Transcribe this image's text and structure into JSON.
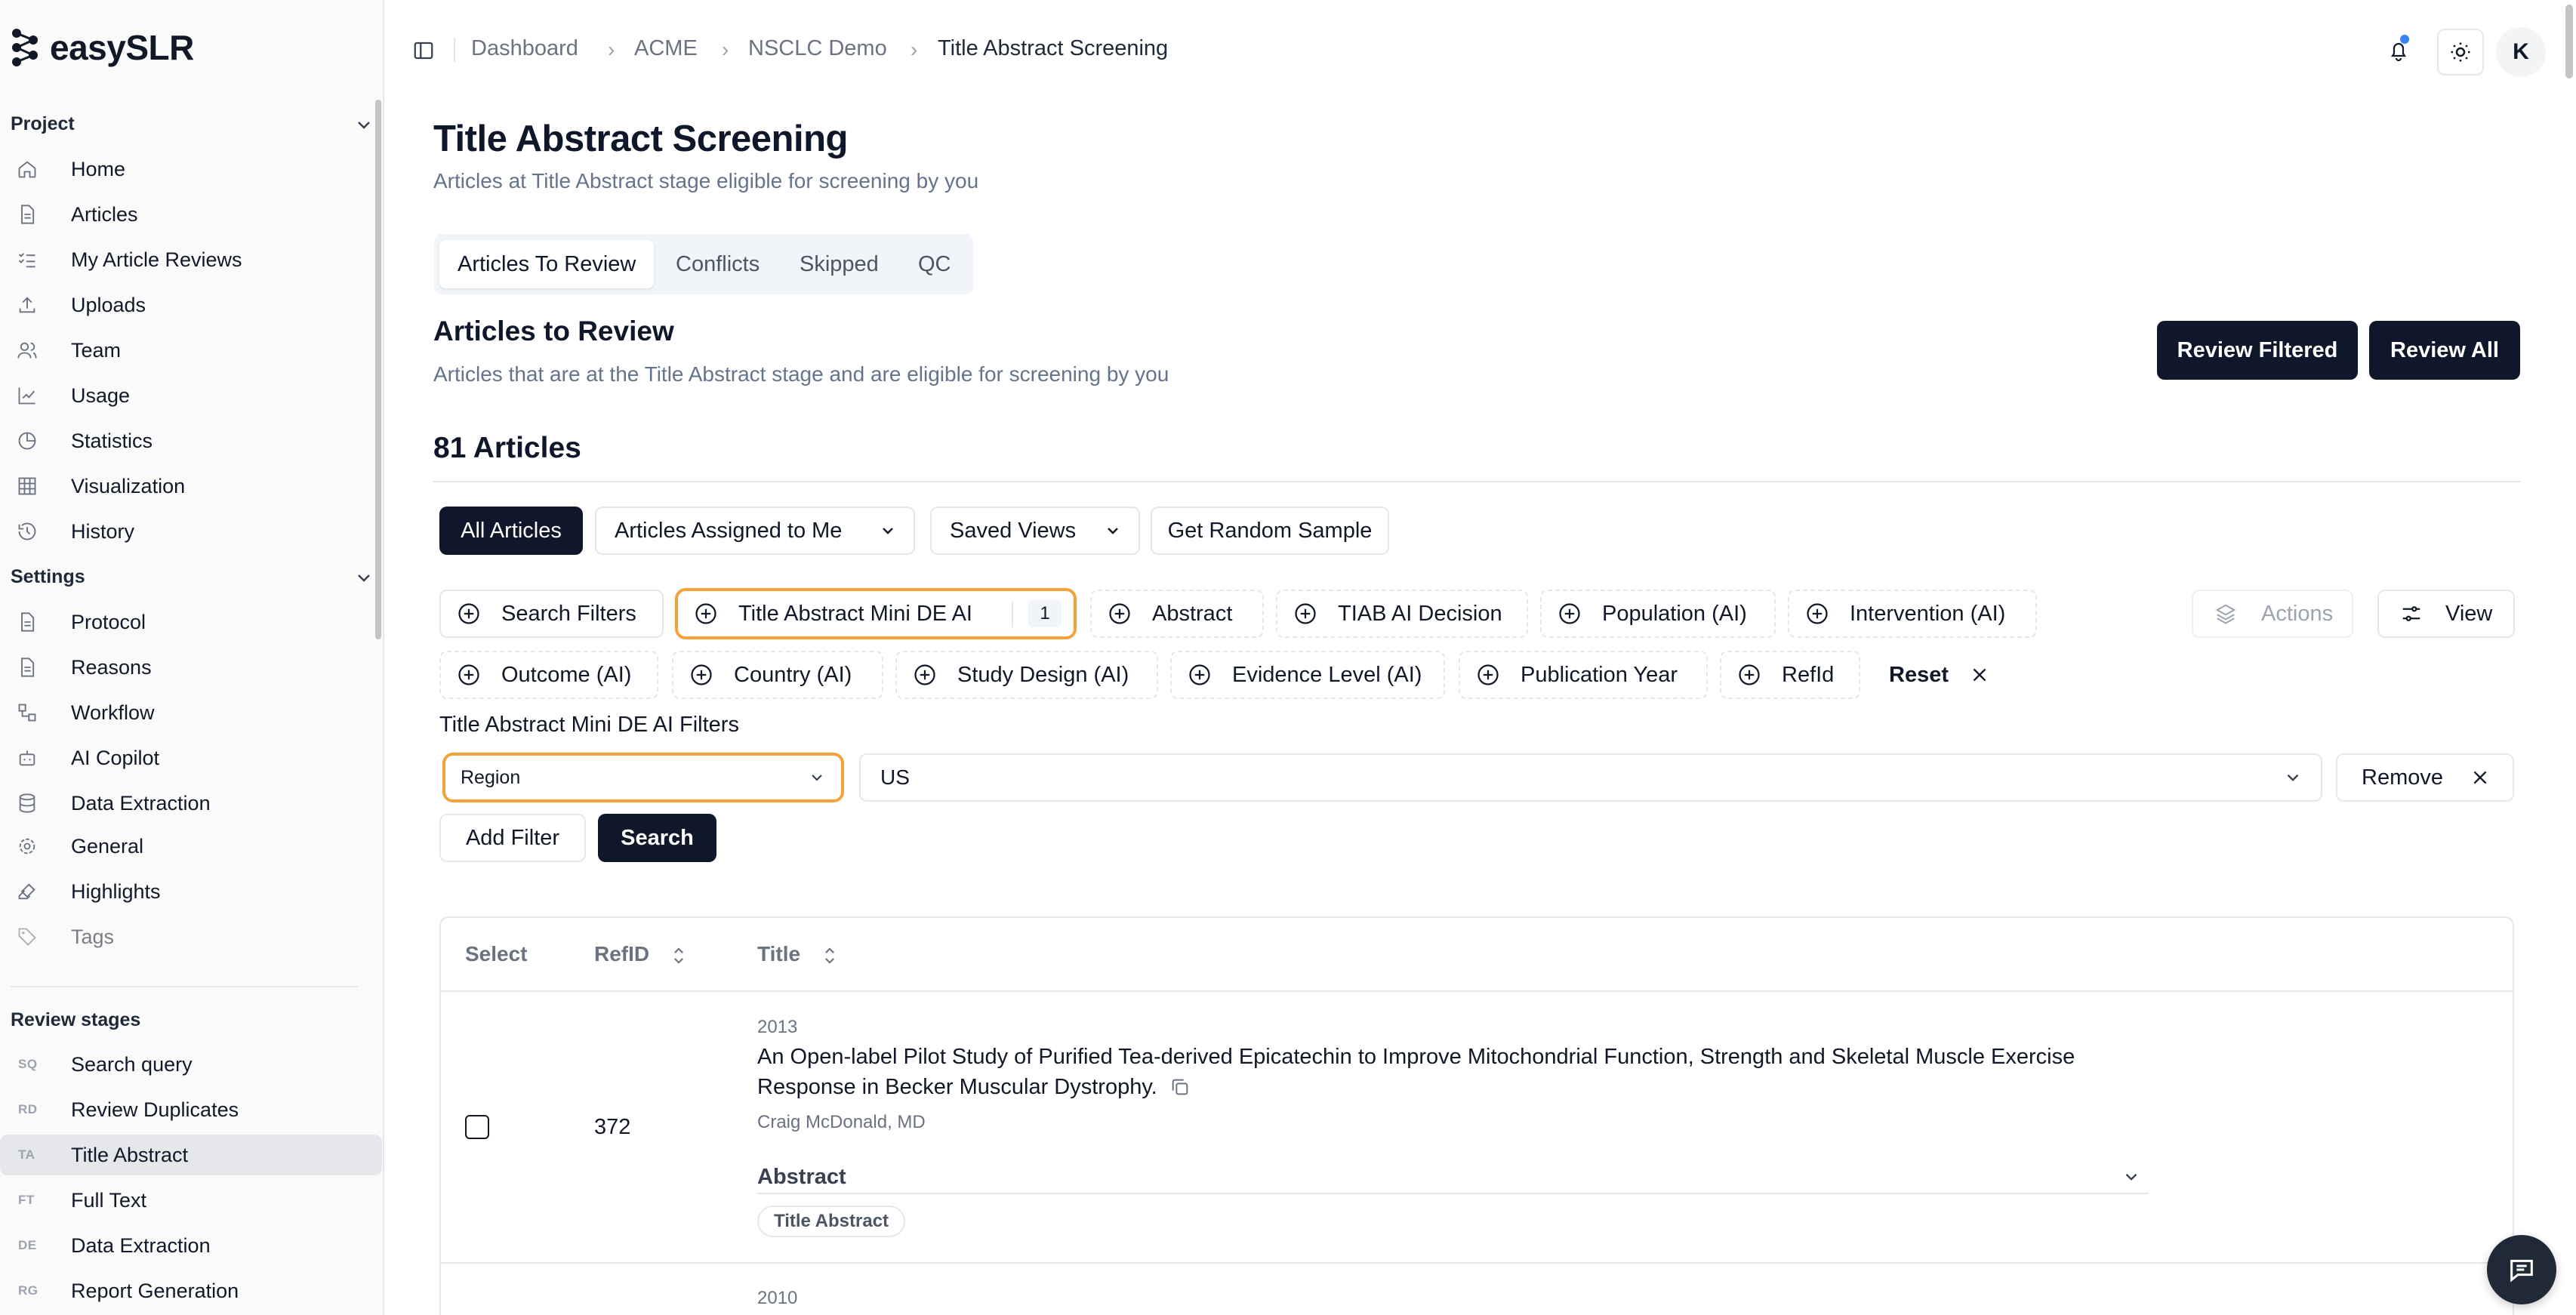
{
  "app": {
    "name": "easySLR"
  },
  "sidebar": {
    "project_header": "Project",
    "project_items": [
      {
        "label": "Home",
        "icon": "home-icon"
      },
      {
        "label": "Articles",
        "icon": "file-text-icon"
      },
      {
        "label": "My Article Reviews",
        "icon": "list-checks-icon"
      },
      {
        "label": "Uploads",
        "icon": "upload-icon"
      },
      {
        "label": "Team",
        "icon": "users-icon"
      },
      {
        "label": "Usage",
        "icon": "line-chart-icon"
      },
      {
        "label": "Statistics",
        "icon": "pie-chart-icon"
      },
      {
        "label": "Visualization",
        "icon": "grid-icon"
      },
      {
        "label": "History",
        "icon": "history-icon"
      }
    ],
    "settings_header": "Settings",
    "settings_items": [
      {
        "label": "Protocol",
        "icon": "file-text-icon"
      },
      {
        "label": "Reasons",
        "icon": "file-text-icon"
      },
      {
        "label": "Workflow",
        "icon": "workflow-icon"
      },
      {
        "label": "AI Copilot",
        "icon": "bot-icon"
      },
      {
        "label": "Data Extraction",
        "icon": "database-icon"
      },
      {
        "label": "General",
        "icon": "gear-icon"
      },
      {
        "label": "Highlights",
        "icon": "highlighter-icon"
      },
      {
        "label": "Tags",
        "icon": "tags-icon"
      }
    ],
    "stages_header": "Review stages",
    "stages": [
      {
        "abbr": "SQ",
        "label": "Search query"
      },
      {
        "abbr": "RD",
        "label": "Review Duplicates"
      },
      {
        "abbr": "TA",
        "label": "Title Abstract"
      },
      {
        "abbr": "FT",
        "label": "Full Text"
      },
      {
        "abbr": "DE",
        "label": "Data Extraction"
      },
      {
        "abbr": "RG",
        "label": "Report Generation"
      }
    ]
  },
  "breadcrumb": [
    "Dashboard",
    "ACME",
    "NSCLC Demo",
    "Title Abstract Screening"
  ],
  "header": {
    "avatar_initial": "K"
  },
  "page": {
    "title": "Title Abstract Screening",
    "subtitle": "Articles at Title Abstract stage eligible for screening by you"
  },
  "tabs": [
    "Articles To Review",
    "Conflicts",
    "Skipped",
    "QC"
  ],
  "section": {
    "title": "Articles to Review",
    "subtitle": "Articles that are at the Title Abstract stage and are eligible for screening by you",
    "review_filtered": "Review Filtered",
    "review_all": "Review All",
    "count_label": "81 Articles"
  },
  "view_buttons": {
    "all": "All Articles",
    "assigned": "Articles Assigned to Me",
    "saved": "Saved Views",
    "random": "Get Random Sample"
  },
  "filters": {
    "row1": [
      "Search Filters",
      "Title Abstract Mini DE AI",
      "Abstract",
      "TIAB AI Decision",
      "Population (AI)",
      "Intervention (AI)"
    ],
    "active_count": "1",
    "actions": "Actions",
    "view": "View",
    "row2": [
      "Outcome (AI)",
      "Country (AI)",
      "Study Design (AI)",
      "Evidence Level (AI)",
      "Publication Year",
      "RefId"
    ],
    "reset": "Reset",
    "panel_title": "Title Abstract Mini DE AI Filters",
    "field_value": "Region",
    "match_value": "US",
    "remove": "Remove",
    "add_filter": "Add Filter",
    "search": "Search"
  },
  "table": {
    "headers": [
      "Select",
      "RefID",
      "Title"
    ],
    "rows": [
      {
        "refid": "372",
        "year": "2013",
        "title_line1": "An Open-label Pilot Study of Purified Tea-derived Epicatechin to Improve Mitochondrial Function, Strength and Skeletal Muscle Exercise",
        "title_line2": "Response in Becker Muscular Dystrophy.",
        "author": "Craig McDonald, MD",
        "abstract_label": "Abstract",
        "stage_badge": "Title Abstract"
      }
    ],
    "next_year": "2010"
  }
}
